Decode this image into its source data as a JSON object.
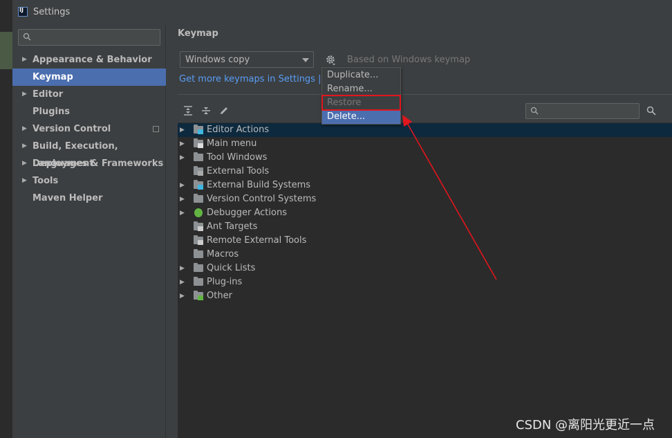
{
  "window": {
    "title": "Settings",
    "app_icon": "intellij-icon"
  },
  "sidebar": {
    "search_placeholder": "",
    "items": [
      {
        "label": "Appearance & Behavior",
        "expandable": true
      },
      {
        "label": "Keymap",
        "expandable": false,
        "selected": true
      },
      {
        "label": "Editor",
        "expandable": true
      },
      {
        "label": "Plugins",
        "expandable": false
      },
      {
        "label": "Version Control",
        "expandable": true,
        "has_project_icon": true
      },
      {
        "label": "Build, Execution, Deployment",
        "expandable": true
      },
      {
        "label": "Languages & Frameworks",
        "expandable": true
      },
      {
        "label": "Tools",
        "expandable": true
      },
      {
        "label": "Maven Helper",
        "expandable": false
      }
    ]
  },
  "main": {
    "title": "Keymap",
    "keymap_value": "Windows copy",
    "based_on": "Based on Windows keymap",
    "get_more_link": "Get more keymaps in Settings | Plug"
  },
  "popup_menu": {
    "items": [
      {
        "label": "Duplicate...",
        "state": "normal"
      },
      {
        "label": "Rename...",
        "state": "normal"
      },
      {
        "label": "Restore Defaults",
        "state": "disabled"
      },
      {
        "label": "Delete...",
        "state": "highlighted"
      }
    ]
  },
  "tree": {
    "rows": [
      {
        "label": "Editor Actions",
        "expandable": true,
        "selected": true,
        "icon": "editor-actions-icon"
      },
      {
        "label": "Main menu",
        "expandable": true,
        "icon": "main-menu-icon"
      },
      {
        "label": "Tool Windows",
        "expandable": true,
        "icon": "folder-icon"
      },
      {
        "label": "External Tools",
        "expandable": false,
        "icon": "external-tools-icon"
      },
      {
        "label": "External Build Systems",
        "expandable": true,
        "icon": "build-systems-icon"
      },
      {
        "label": "Version Control Systems",
        "expandable": true,
        "icon": "folder-icon"
      },
      {
        "label": "Debugger Actions",
        "expandable": true,
        "icon": "bug-icon"
      },
      {
        "label": "Ant Targets",
        "expandable": false,
        "icon": "ant-targets-icon"
      },
      {
        "label": "Remote External Tools",
        "expandable": false,
        "icon": "remote-tools-icon"
      },
      {
        "label": "Macros",
        "expandable": false,
        "icon": "folder-icon"
      },
      {
        "label": "Quick Lists",
        "expandable": true,
        "icon": "folder-icon"
      },
      {
        "label": "Plug-ins",
        "expandable": true,
        "icon": "folder-icon"
      },
      {
        "label": "Other",
        "expandable": true,
        "icon": "other-icon"
      }
    ]
  },
  "watermark": "CSDN @离阳光更近一点",
  "colors": {
    "selection": "#4b6eaf",
    "tree_selection": "#0d293e",
    "link": "#589df6",
    "annotation_red": "#e2161d"
  }
}
